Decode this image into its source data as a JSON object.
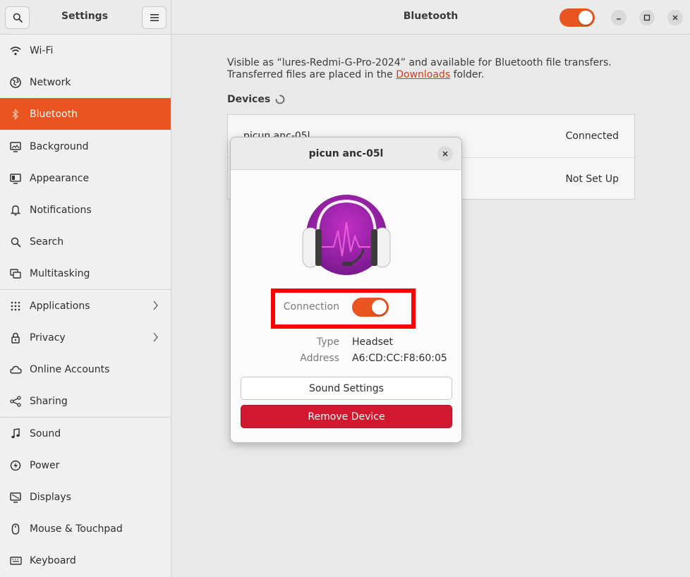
{
  "sidebar_header": {
    "title": "Settings",
    "search_icon": "search-icon",
    "menu_icon": "hamburger-menu-icon"
  },
  "main_header": {
    "title": "Bluetooth",
    "bluetooth_enabled": true
  },
  "sidebar": {
    "items": [
      {
        "label": "Wi-Fi",
        "icon": "wifi-icon"
      },
      {
        "label": "Network",
        "icon": "network-icon"
      },
      {
        "label": "Bluetooth",
        "icon": "bluetooth-icon",
        "active": true
      },
      {
        "label": "Background",
        "icon": "background-icon"
      },
      {
        "label": "Appearance",
        "icon": "appearance-icon"
      },
      {
        "label": "Notifications",
        "icon": "bell-icon"
      },
      {
        "label": "Search",
        "icon": "search-icon"
      },
      {
        "label": "Multitasking",
        "icon": "multitasking-icon"
      },
      {
        "label": "Applications",
        "icon": "grid-icon",
        "has_submenu": true
      },
      {
        "label": "Privacy",
        "icon": "lock-icon",
        "has_submenu": true
      },
      {
        "label": "Online Accounts",
        "icon": "cloud-icon"
      },
      {
        "label": "Sharing",
        "icon": "share-icon"
      },
      {
        "label": "Sound",
        "icon": "music-note-icon"
      },
      {
        "label": "Power",
        "icon": "power-icon"
      },
      {
        "label": "Displays",
        "icon": "display-icon"
      },
      {
        "label": "Mouse & Touchpad",
        "icon": "mouse-icon"
      },
      {
        "label": "Keyboard",
        "icon": "keyboard-icon"
      }
    ]
  },
  "main": {
    "info_line1": "Visible as “lures-Redmi-G-Pro-2024” and available for Bluetooth file transfers.",
    "info_line2_before": "Transferred files are placed in the ",
    "info_link": "Downloads",
    "info_line2_after": " folder.",
    "devices_title": "Devices",
    "devices": [
      {
        "name": "picun anc-05l",
        "status": "Connected"
      },
      {
        "name": "",
        "status": "Not Set Up"
      }
    ]
  },
  "dialog": {
    "title": "picun anc-05l",
    "connection_label": "Connection",
    "connection_on": true,
    "type_label": "Type",
    "type_value": "Headset",
    "address_label": "Address",
    "address_value": "A6:CD:CC:F8:60:05",
    "sound_settings_label": "Sound Settings",
    "remove_device_label": "Remove Device"
  },
  "colors": {
    "accent": "#e95420",
    "danger": "#d0182e",
    "highlight": "#ff0000"
  }
}
